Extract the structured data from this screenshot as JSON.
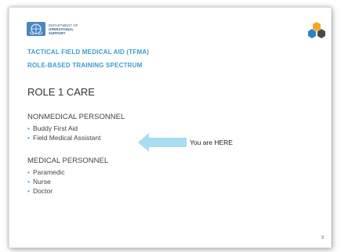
{
  "header": {
    "org_line1": "DEPARTMENT OF",
    "org_line2": "OPERATIONAL",
    "org_line3": "SUPPORT",
    "emblem_icon": "un-emblem-icon",
    "corner_icon": "colored-blocks-logo-icon"
  },
  "kicker": {
    "line1": "TACTICAL FIELD MEDICAL AID (TFMA)",
    "line2": "ROLE-BASED TRAINING SPECTRUM"
  },
  "title": "ROLE 1 CARE",
  "nonmedical": {
    "heading": "NONMEDICAL PERSONNEL",
    "items": [
      "Buddy First Aid",
      "Field Medical Assistant"
    ]
  },
  "medical": {
    "heading": "MEDICAL PERSONNEL",
    "items": [
      "Paramedic",
      "Nurse",
      "Doctor"
    ]
  },
  "callout": {
    "label": "You are HERE",
    "icon": "left-arrow-icon"
  },
  "page_number": "3",
  "colors": {
    "accent": "#3d9ccf",
    "arrow": "#a9dcf0",
    "text": "#444444"
  }
}
